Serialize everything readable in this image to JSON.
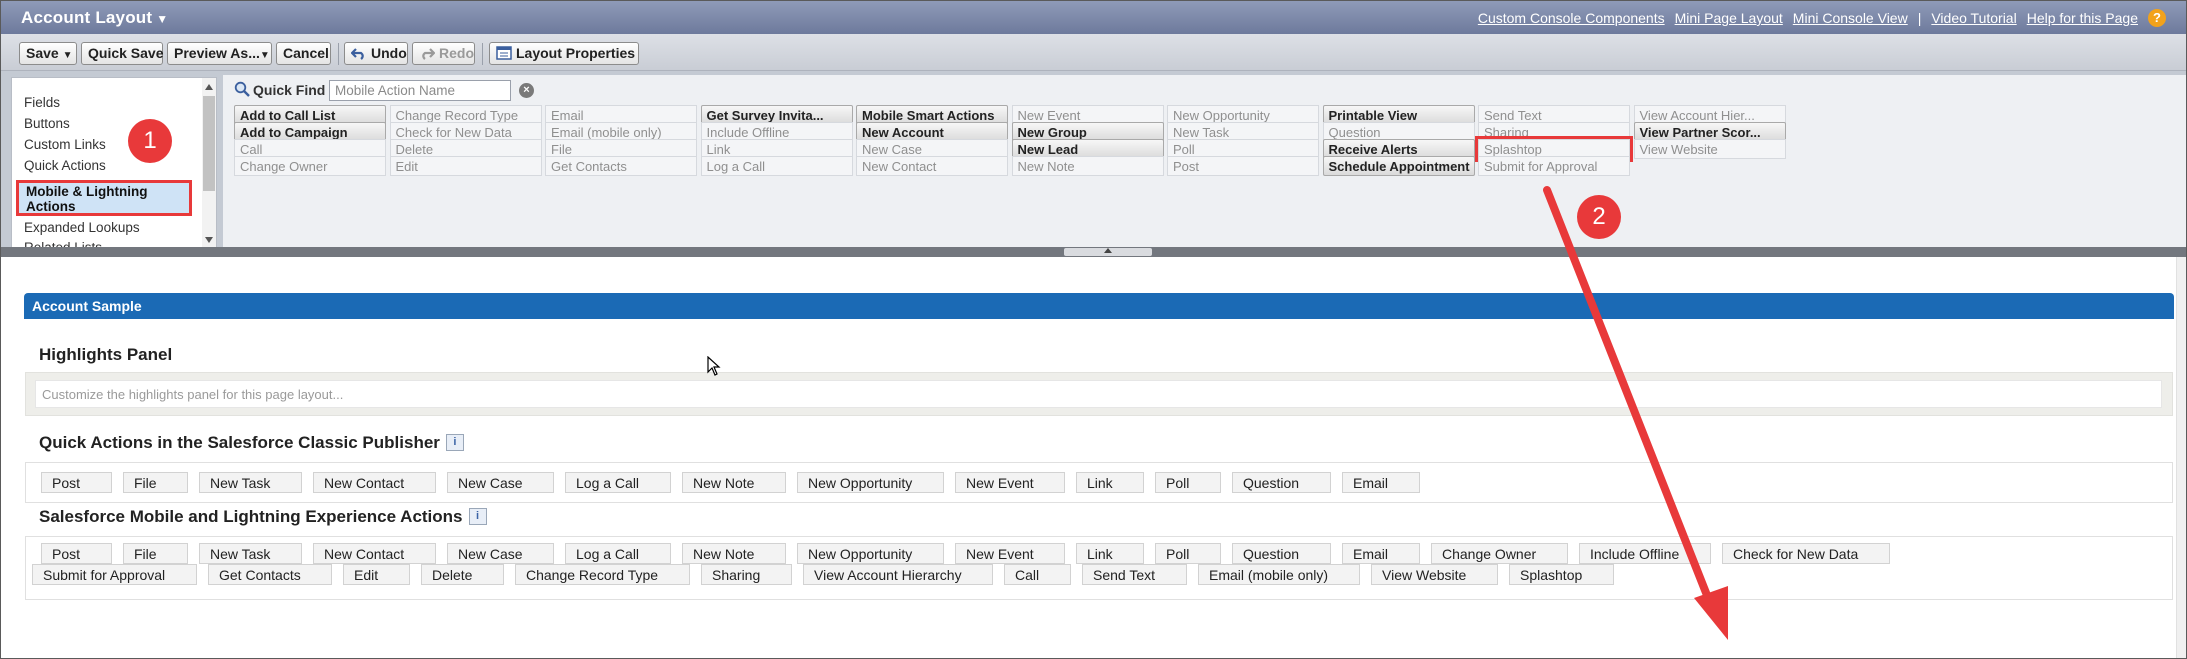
{
  "header": {
    "title": "Account Layout",
    "links": [
      "Custom Console Components",
      "Mini Page Layout",
      "Mini Console View",
      "Video Tutorial",
      "Help for this Page"
    ]
  },
  "toolbar": {
    "save": "Save",
    "quick_save": "Quick Save",
    "preview_as": "Preview As...",
    "cancel": "Cancel",
    "undo": "Undo",
    "redo": "Redo",
    "layout_properties": "Layout Properties"
  },
  "palette": {
    "categories": [
      "Fields",
      "Buttons",
      "Custom Links",
      "Quick Actions",
      "Mobile & Lightning Actions",
      "Expanded Lookups",
      "Related Lists"
    ],
    "selected": "Mobile & Lightning\nActions",
    "quick_find_label": "Quick Find",
    "quick_find_placeholder": "Mobile Action Name",
    "columns": [
      [
        {
          "label": "Add to Call List",
          "state": "avail"
        },
        {
          "label": "Add to Campaign",
          "state": "avail"
        },
        {
          "label": "Call",
          "state": "used"
        },
        {
          "label": "Change Owner",
          "state": "used"
        }
      ],
      [
        {
          "label": "Change Record Type",
          "state": "used"
        },
        {
          "label": "Check for New Data",
          "state": "used"
        },
        {
          "label": "Delete",
          "state": "used"
        },
        {
          "label": "Edit",
          "state": "used"
        }
      ],
      [
        {
          "label": "Email",
          "state": "used"
        },
        {
          "label": "Email (mobile only)",
          "state": "used"
        },
        {
          "label": "File",
          "state": "used"
        },
        {
          "label": "Get Contacts",
          "state": "used"
        }
      ],
      [
        {
          "label": "Get Survey Invita...",
          "state": "avail"
        },
        {
          "label": "Include Offline",
          "state": "used"
        },
        {
          "label": "Link",
          "state": "used"
        },
        {
          "label": "Log a Call",
          "state": "used"
        }
      ],
      [
        {
          "label": "Mobile Smart Actions",
          "state": "avail"
        },
        {
          "label": "New Account",
          "state": "avail"
        },
        {
          "label": "New Case",
          "state": "used"
        },
        {
          "label": "New Contact",
          "state": "used"
        }
      ],
      [
        {
          "label": "New Event",
          "state": "used"
        },
        {
          "label": "New Group",
          "state": "avail"
        },
        {
          "label": "New Lead",
          "state": "avail"
        },
        {
          "label": "New Note",
          "state": "used"
        }
      ],
      [
        {
          "label": "New Opportunity",
          "state": "used"
        },
        {
          "label": "New Task",
          "state": "used"
        },
        {
          "label": "Poll",
          "state": "used"
        },
        {
          "label": "Post",
          "state": "used"
        }
      ],
      [
        {
          "label": "Printable View",
          "state": "avail"
        },
        {
          "label": "Question",
          "state": "used"
        },
        {
          "label": "Receive Alerts",
          "state": "avail"
        },
        {
          "label": "Schedule Appointment",
          "state": "avail"
        }
      ],
      [
        {
          "label": "Send Text",
          "state": "used"
        },
        {
          "label": "Sharing",
          "state": "used"
        },
        {
          "label": "Splashtop",
          "state": "used",
          "highlight": true
        },
        {
          "label": "Submit for Approval",
          "state": "used"
        }
      ],
      [
        {
          "label": "View Account Hier...",
          "state": "used"
        },
        {
          "label": "View Partner Scor...",
          "state": "avail"
        },
        {
          "label": "View Website",
          "state": "used"
        }
      ]
    ]
  },
  "layout": {
    "sample_title": "Account Sample",
    "highlights_title": "Highlights Panel",
    "highlights_hint": "Customize the highlights panel for this page layout...",
    "classic_title": "Quick Actions in the Salesforce Classic Publisher",
    "classic_actions": [
      "Post",
      "File",
      "New Task",
      "New Contact",
      "New Case",
      "Log a Call",
      "New Note",
      "New Opportunity",
      "New Event",
      "Link",
      "Poll",
      "Question",
      "Email"
    ],
    "lightning_title": "Salesforce Mobile and Lightning Experience Actions",
    "lightning_row1": [
      "Post",
      "File",
      "New Task",
      "New Contact",
      "New Case",
      "Log a Call",
      "New Note",
      "New Opportunity",
      "New Event",
      "Link",
      "Poll",
      "Question",
      "Email",
      "Change Owner",
      "Include Offline",
      "Check for New Data"
    ],
    "lightning_row2": [
      "Submit for Approval",
      "Get Contacts",
      "Edit",
      "Delete",
      "Change Record Type",
      "Sharing",
      "View Account Hierarchy",
      "Call",
      "Send Text",
      "Email (mobile only)",
      "View Website",
      "Splashtop"
    ]
  },
  "annotations": {
    "badge1": "1",
    "badge2": "2",
    "info": "i"
  },
  "colors": {
    "accent_red": "#e8393a",
    "section_blue": "#1b6ab5",
    "header": "#7f8bab"
  }
}
